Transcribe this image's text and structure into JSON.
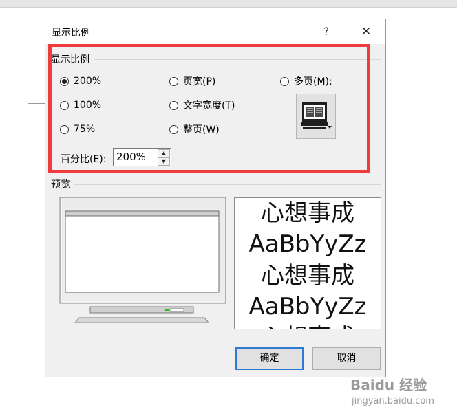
{
  "dialog": {
    "title": "显示比例",
    "help_label": "?",
    "close_label": "✕"
  },
  "zoom_group": {
    "label": "显示比例",
    "options": [
      {
        "label": "200%",
        "checked": true
      },
      {
        "label": "100%",
        "checked": false
      },
      {
        "label": "75%",
        "checked": false
      },
      {
        "label": "页宽(P)",
        "checked": false
      },
      {
        "label": "文字宽度(T)",
        "checked": false
      },
      {
        "label": "整页(W)",
        "checked": false
      },
      {
        "label": "多页(M):",
        "checked": false
      }
    ],
    "percent_label": "百分比(E):",
    "percent_value": "200%"
  },
  "preview": {
    "label": "预览",
    "sample_lines": [
      "心想事成",
      "AaBbYyZz",
      "心想事成",
      "AaBbYyZz",
      "心想事成"
    ]
  },
  "buttons": {
    "ok": "确定",
    "cancel": "取消"
  },
  "watermark": {
    "brand": "Baidu 经验",
    "url": "jingyan.baidu.com"
  },
  "colors": {
    "highlight_border": "#ef3a3e",
    "dialog_border": "#6f9fd3",
    "default_button_border": "#2f7ad1"
  }
}
